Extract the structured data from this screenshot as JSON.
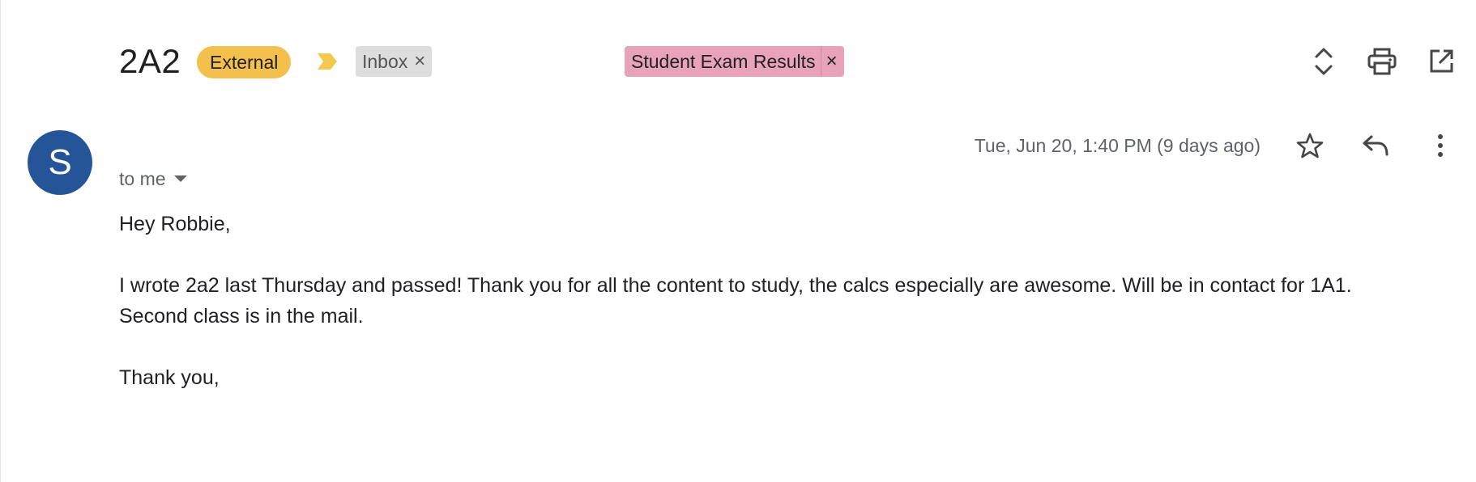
{
  "header": {
    "subject": "2A2",
    "chips": {
      "external": "External",
      "inbox": "Inbox",
      "label": "Student Exam Results",
      "remove_symbol": "×"
    },
    "icons": {
      "importance": "importance-marker-icon",
      "expand": "expand-collapse-icon",
      "print": "print-icon",
      "popout": "open-in-new-window-icon"
    }
  },
  "message": {
    "sender_initial": "S",
    "recipient": "to me",
    "timestamp": "Tue, Jun 20, 1:40 PM (9 days ago)",
    "icons": {
      "star": "star-icon",
      "reply": "reply-icon",
      "more": "more-vert-icon"
    },
    "body": {
      "greeting": "Hey Robbie,",
      "paragraph1_line1": "I wrote 2a2 last Thursday and passed! Thank you for all the content to study, the calcs especially are awesome. Will be in contact for 1A1.",
      "paragraph1_line2": "Second class is in the mail.",
      "closing": "Thank you,"
    }
  },
  "colors": {
    "external_chip": "#f4c04d",
    "inbox_chip": "#dddddd",
    "label_chip": "#e8a2b9",
    "avatar": "#255598",
    "importance": "#f2c94c"
  }
}
